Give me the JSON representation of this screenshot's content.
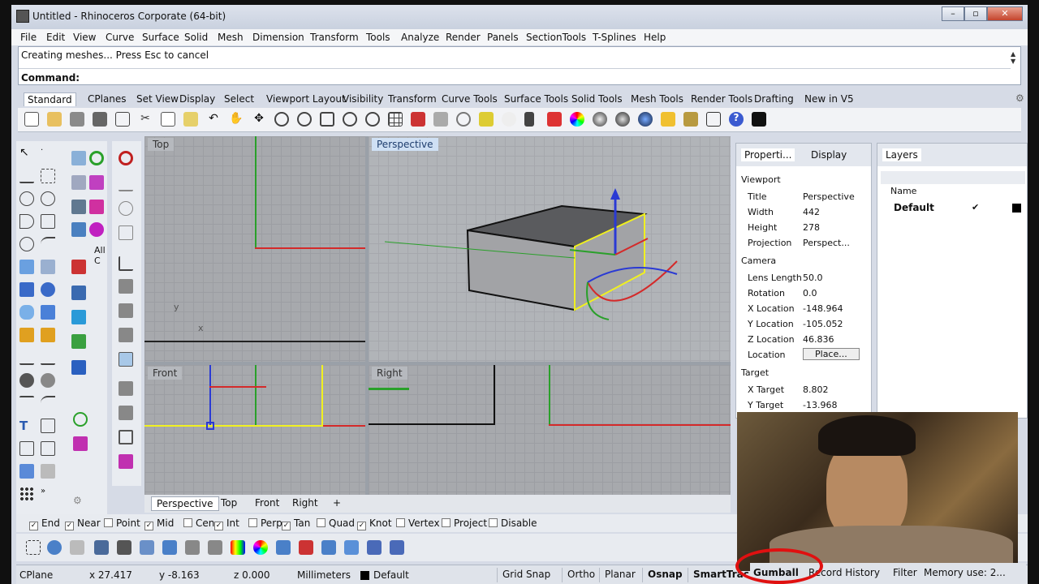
{
  "window": {
    "title": "Untitled - Rhinoceros Corporate (64-bit)",
    "buttons": [
      "–",
      "▫",
      "✕"
    ]
  },
  "menu": [
    "File",
    "Edit",
    "View",
    "Curve",
    "Surface",
    "Solid",
    "Mesh",
    "Dimension",
    "Transform",
    "Tools",
    "Analyze",
    "Render",
    "Panels",
    "SectionTools",
    "T-Splines",
    "Help"
  ],
  "command": {
    "history": "Creating meshes... Press Esc to cancel",
    "prompt": "Command:"
  },
  "toolbar_tabs": [
    "Standard",
    "CPlanes",
    "Set View",
    "Display",
    "Select",
    "Viewport Layout",
    "Visibility",
    "Transform",
    "Curve Tools",
    "Surface Tools",
    "Solid Tools",
    "Mesh Tools",
    "Render Tools",
    "Drafting",
    "New in V5"
  ],
  "left_tool_text": "All C",
  "viewports": {
    "top": "Top",
    "perspective": "Perspective",
    "front": "Front",
    "right": "Right"
  },
  "viewport_tabs": [
    "Perspective",
    "Top",
    "Front",
    "Right",
    "+"
  ],
  "properties": {
    "tabs": [
      "Properti...",
      "Display"
    ],
    "viewport_section": "Viewport",
    "rows_viewport": [
      {
        "k": "Title",
        "v": "Perspective"
      },
      {
        "k": "Width",
        "v": "442"
      },
      {
        "k": "Height",
        "v": "278"
      },
      {
        "k": "Projection",
        "v": "Perspect..."
      }
    ],
    "camera_section": "Camera",
    "rows_camera": [
      {
        "k": "Lens Length",
        "v": "50.0"
      },
      {
        "k": "Rotation",
        "v": "0.0"
      },
      {
        "k": "X Location",
        "v": "-148.964"
      },
      {
        "k": "Y Location",
        "v": "-105.052"
      },
      {
        "k": "Z Location",
        "v": "46.836"
      },
      {
        "k": "Location",
        "v": "Place..."
      }
    ],
    "target_section": "Target",
    "rows_target": [
      {
        "k": "X Target",
        "v": "8.802"
      },
      {
        "k": "Y Target",
        "v": "-13.968"
      }
    ]
  },
  "layers": {
    "title": "Layers",
    "col_name": "Name",
    "row_name": "Default",
    "check": "✔"
  },
  "osnap": [
    {
      "label": "End",
      "checked": true
    },
    {
      "label": "Near",
      "checked": true
    },
    {
      "label": "Point",
      "checked": false
    },
    {
      "label": "Mid",
      "checked": true
    },
    {
      "label": "Cen",
      "checked": false
    },
    {
      "label": "Int",
      "checked": true
    },
    {
      "label": "Perp",
      "checked": false
    },
    {
      "label": "Tan",
      "checked": true
    },
    {
      "label": "Quad",
      "checked": false
    },
    {
      "label": "Knot",
      "checked": true
    },
    {
      "label": "Vertex",
      "checked": false
    },
    {
      "label": "Project",
      "checked": false
    },
    {
      "label": "Disable",
      "checked": false
    }
  ],
  "status": {
    "cplane": "CPlane",
    "x": "x 27.417",
    "y": "y -8.163",
    "z": "z 0.000",
    "units": "Millimeters",
    "layer": "Default",
    "grid_snap": "Grid Snap",
    "ortho": "Ortho",
    "planar": "Planar",
    "osnap": "Osnap",
    "smarttrack": "SmartTrac",
    "gumball": "Gumball",
    "record_history": "Record History",
    "filter": "Filter",
    "memory": "Memory use: 2..."
  },
  "colors": {
    "x_axis": "#d42a2a",
    "y_axis": "#2aa02a",
    "z_axis": "#2a3ad4",
    "selection": "#f0f020",
    "annotation_circle": "#e01010"
  }
}
